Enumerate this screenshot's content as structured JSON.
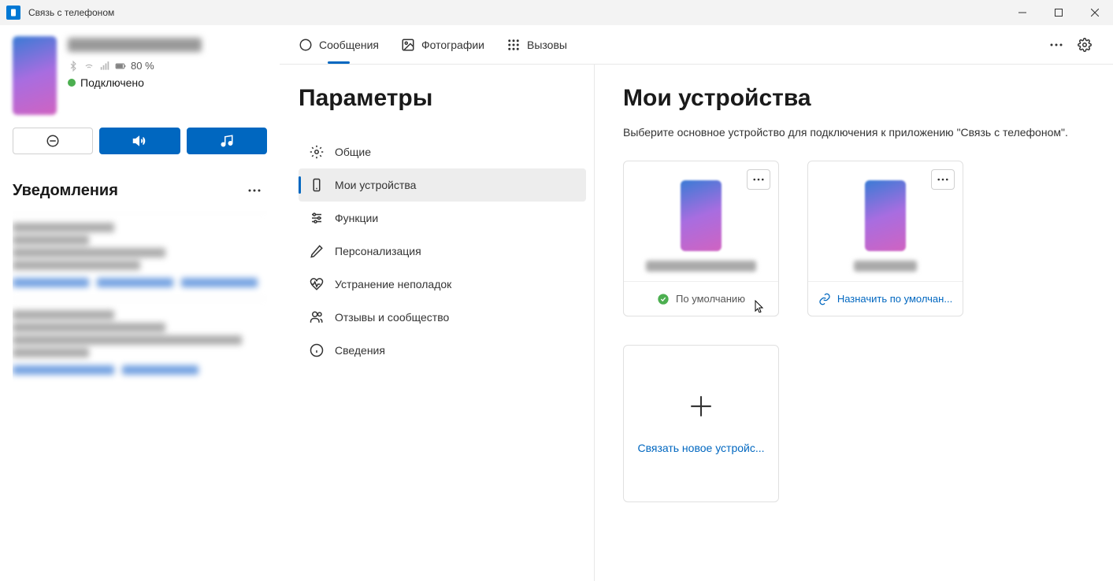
{
  "titlebar": {
    "title": "Связь с телефоном"
  },
  "sidebar": {
    "battery": "80 %",
    "connected_label": "Подключено",
    "notifications_title": "Уведомления"
  },
  "tabs": {
    "messages": "Сообщения",
    "photos": "Фотографии",
    "calls": "Вызовы"
  },
  "settings": {
    "title": "Параметры",
    "items": [
      "Общие",
      "Мои устройства",
      "Функции",
      "Персонализация",
      "Устранение неполадок",
      "Отзывы и сообщество",
      "Сведения"
    ]
  },
  "main": {
    "title": "Мои устройства",
    "description": "Выберите основное устройство для подключения к приложению \"Связь с телефоном\".",
    "default_label": "По умолчанию",
    "assign_label": "Назначить по умолчан...",
    "link_new_label": "Связать новое устройс..."
  }
}
